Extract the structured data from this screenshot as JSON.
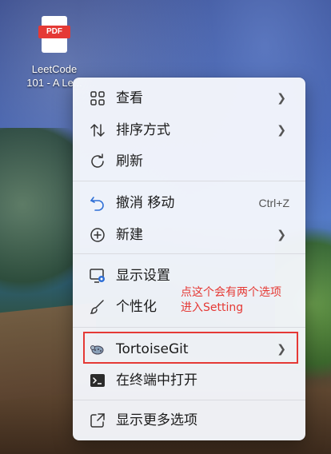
{
  "desktop": {
    "file_badge": "PDF",
    "file_label_line1": "LeetCode",
    "file_label_line2": "101 - A Le..."
  },
  "menu": {
    "items": [
      {
        "label": "查看",
        "icon": "grid-icon",
        "has_submenu": true
      },
      {
        "label": "排序方式",
        "icon": "sort-icon",
        "has_submenu": true
      },
      {
        "label": "刷新",
        "icon": "refresh-icon",
        "has_submenu": false
      },
      {
        "label": "撤消 移动",
        "icon": "undo-icon",
        "shortcut": "Ctrl+Z"
      },
      {
        "label": "新建",
        "icon": "new-plus-icon",
        "has_submenu": true
      },
      {
        "label": "显示设置",
        "icon": "display-settings-icon",
        "has_submenu": false
      },
      {
        "label": "个性化",
        "icon": "brush-icon",
        "has_submenu": false
      },
      {
        "label": "TortoiseGit",
        "icon": "tortoisegit-icon",
        "has_submenu": true
      },
      {
        "label": "在终端中打开",
        "icon": "terminal-icon",
        "has_submenu": false
      },
      {
        "label": "显示更多选项",
        "icon": "share-icon",
        "has_submenu": false
      }
    ]
  },
  "annotation": {
    "line1": "点这个会有两个选项",
    "line2": "进入Setting",
    "color": "#e53935"
  }
}
